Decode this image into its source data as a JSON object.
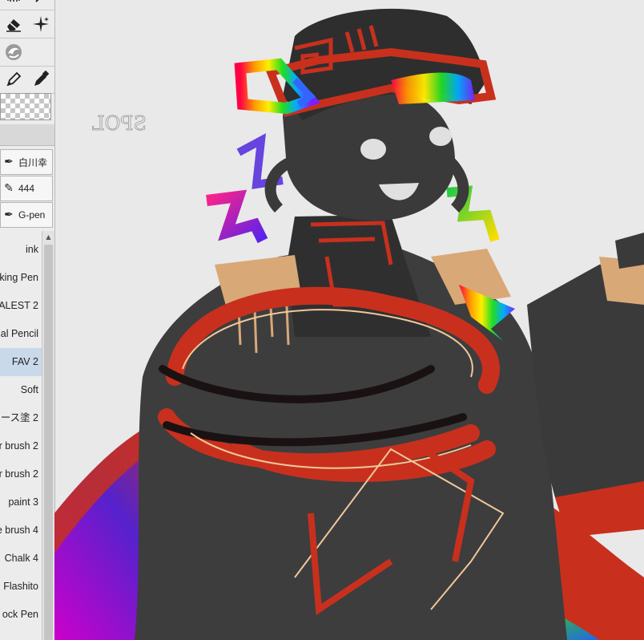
{
  "tools": {
    "row1": [
      "select-rect-icon",
      "magic-wand-icon"
    ],
    "row2": [
      "eraser-icon",
      "sparkle-icon"
    ],
    "row3": [
      "color-fill-icon"
    ],
    "row4": [
      "pen-icon",
      "marker-icon"
    ],
    "color_swatch": "transparent"
  },
  "presets": [
    {
      "icon": "pen-icon",
      "label": "白川幸"
    },
    {
      "icon": "pencil-icon",
      "label": "444"
    },
    {
      "icon": "g-pen-icon",
      "label": "G-pen"
    }
  ],
  "brushes": [
    {
      "label": "ink",
      "selected": false
    },
    {
      "label": "king Pen",
      "selected": false
    },
    {
      "label": "ALEST 2",
      "selected": false
    },
    {
      "label": "al Pencil",
      "selected": false
    },
    {
      "label": "FAV 2",
      "selected": true
    },
    {
      "label": "Soft",
      "selected": false
    },
    {
      "label": "ース塗 2",
      "selected": false
    },
    {
      "label": "r brush 2",
      "selected": false
    },
    {
      "label": "r brush 2",
      "selected": false
    },
    {
      "label": "paint 3",
      "selected": false
    },
    {
      "label": "e brush 4",
      "selected": false
    },
    {
      "label": "Chalk 4",
      "selected": false
    },
    {
      "label": "Flashito",
      "selected": false
    },
    {
      "label": "ock Pen",
      "selected": false
    }
  ],
  "canvas": {
    "sketch_text": "SPOL",
    "colors": {
      "background": "#e9e9ea",
      "figure": "#3d3d3e",
      "red": "#c8301d",
      "tan": "#d9a877",
      "face_white": "#e0e0e0"
    }
  }
}
